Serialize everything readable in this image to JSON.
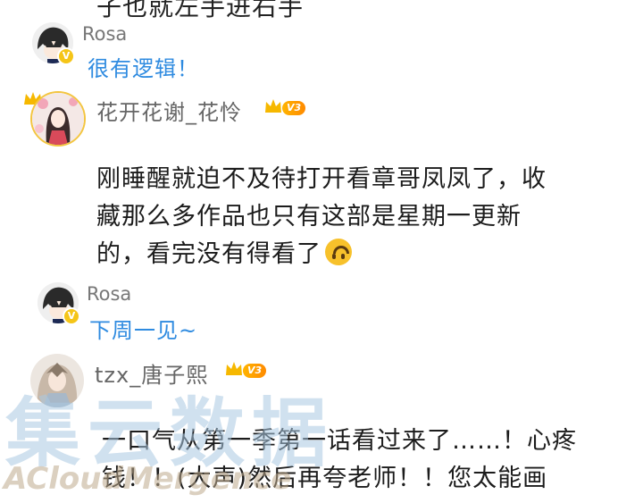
{
  "top_partial_text": "子也就左手进右手",
  "comments": [
    {
      "type": "reply",
      "author": "Rosa",
      "text": "很有逻辑！"
    },
    {
      "type": "comment",
      "author": "花开花谢_花怜",
      "level_badge": "V3",
      "lines": [
        "刚睡醒就迫不及待打开看章哥凤凤了，收",
        "藏那么多作品也只有这部是星期一更新",
        "的，看完没有得看了"
      ],
      "emoji_icon": "upside-down-face-icon"
    },
    {
      "type": "reply",
      "author": "Rosa",
      "text": "下周一见~"
    },
    {
      "type": "comment",
      "author": "tzx_唐子熙",
      "level_badge": "V3",
      "lines": [
        "一口气从第一季第一话看过来了……！心疼",
        "钱！！(大声)然后再夸老师！！您太能画"
      ]
    }
  ],
  "verified_badge": "V",
  "watermark": {
    "main": "集云数据",
    "sub": "ACloudMergence"
  },
  "colors": {
    "reply_blue": "#2f8be0",
    "name_gray": "#777777",
    "badge_gold": "#f5c518"
  }
}
